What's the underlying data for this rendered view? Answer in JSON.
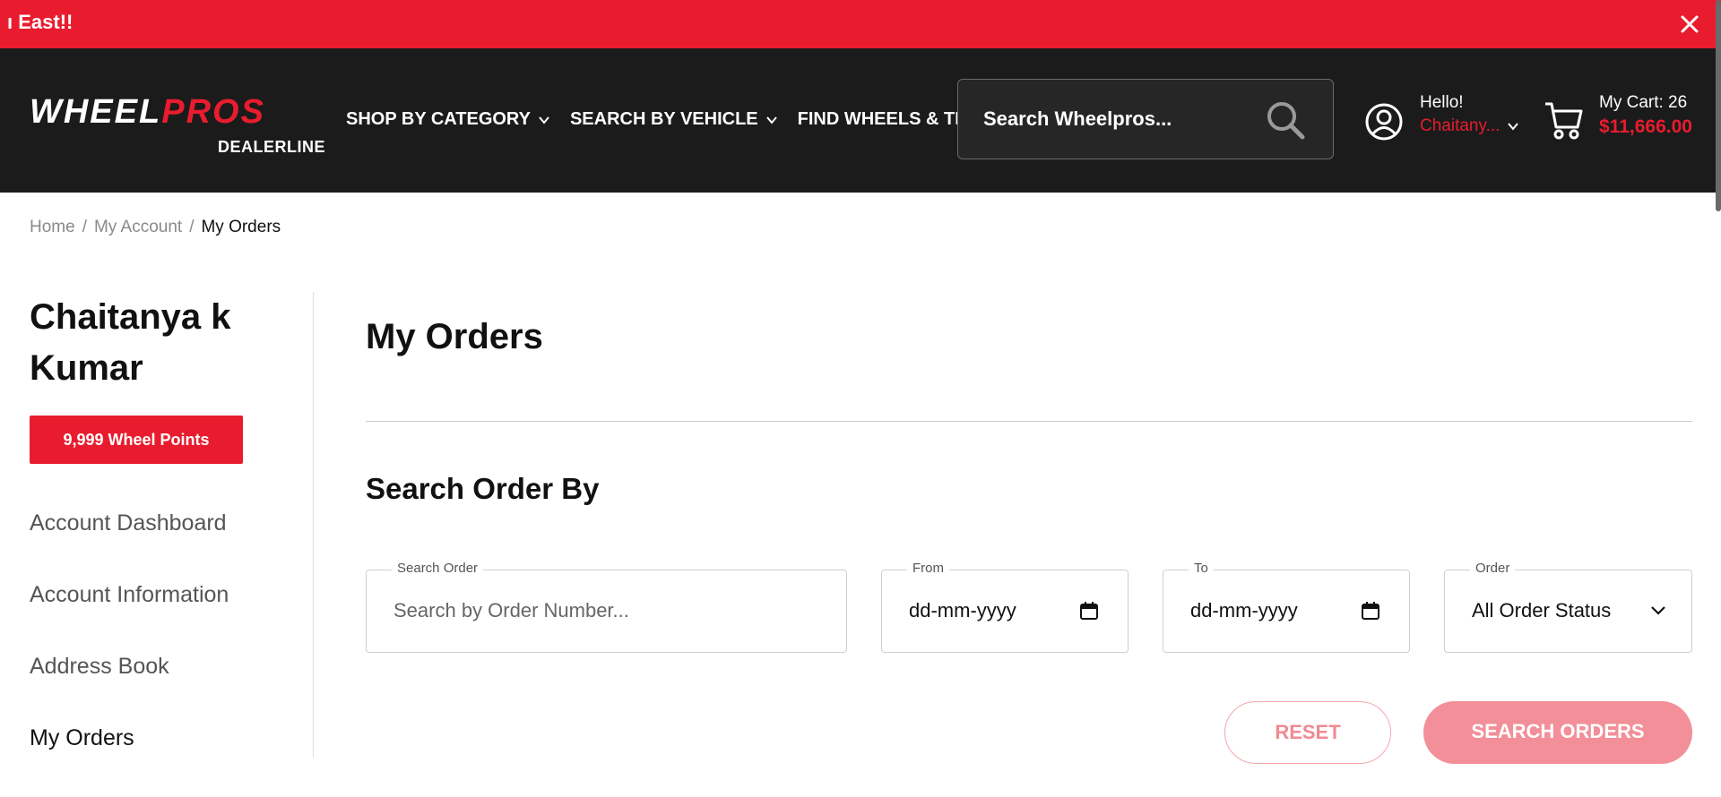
{
  "announcement": {
    "text": "ı East!!"
  },
  "header": {
    "logo": {
      "wheel": "WHEEL",
      "pros": "PROS",
      "sub": "DEALERLINE"
    },
    "nav": [
      {
        "label": "SHOP BY CATEGORY",
        "has_dropdown": true
      },
      {
        "label": "SEARCH BY VEHICLE",
        "has_dropdown": true
      },
      {
        "label": "FIND WHEELS & TIRES",
        "has_dropdown": false
      }
    ],
    "search": {
      "placeholder": "Search Wheelpros..."
    },
    "user": {
      "greeting": "Hello!",
      "name": "Chaitany..."
    },
    "cart": {
      "count_label": "My Cart: 26",
      "amount": "$11,666.00"
    }
  },
  "breadcrumb": {
    "items": [
      "Home",
      "My Account"
    ],
    "current": "My Orders"
  },
  "sidebar": {
    "customer_name": "Chaitanya k Kumar",
    "points_label": "9,999 Wheel Points",
    "menu": [
      "Account Dashboard",
      "Account Information",
      "Address Book",
      "My Orders"
    ]
  },
  "main": {
    "title": "My Orders",
    "section_title": "Search Order By",
    "filters": {
      "search_order": {
        "label": "Search Order",
        "placeholder": "Search by Order Number..."
      },
      "from": {
        "label": "From",
        "value": "dd-mm-yyyy"
      },
      "to": {
        "label": "To",
        "value": "dd-mm-yyyy"
      },
      "order": {
        "label": "Order",
        "value": "All Order Status"
      }
    },
    "buttons": {
      "reset": "RESET",
      "search": "SEARCH ORDERS"
    }
  },
  "colors": {
    "brand_red": "#e81c2e",
    "header_bg": "#1b1b1b",
    "button_pink": "#f28f98"
  },
  "icons": [
    "close-icon",
    "chevron-down-icon",
    "search-icon",
    "user-icon",
    "cart-icon",
    "calendar-icon"
  ]
}
